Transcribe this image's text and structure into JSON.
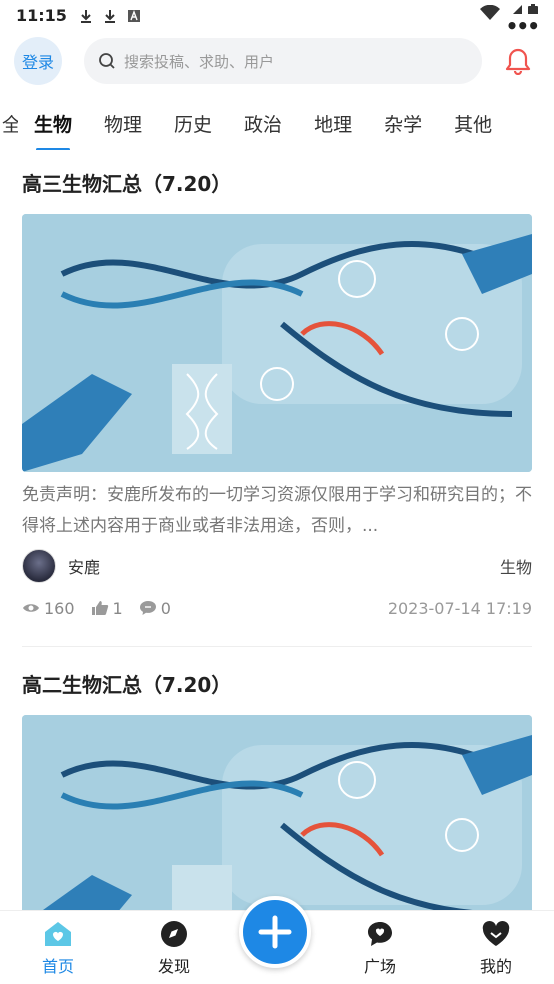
{
  "status_bar": {
    "time": "11:15"
  },
  "header": {
    "login_label": "登录",
    "search_placeholder": "搜索投稿、求助、用户"
  },
  "tabs": {
    "partial_label": "全",
    "items": [
      "生物",
      "物理",
      "历史",
      "政治",
      "地理",
      "杂学",
      "其他"
    ],
    "more": "•••"
  },
  "feed": {
    "posts": [
      {
        "title": "高三生物汇总（7.20）",
        "description": "免责声明：安鹿所发布的一切学习资源仅限用于学习和研究目的；不得将上述内容用于商业或者非法用途，否则，...",
        "author": "安鹿",
        "category": "生物",
        "views": "160",
        "likes": "1",
        "comments": "0",
        "date": "2023-07-14 17:19"
      },
      {
        "title": "高二生物汇总（7.20）"
      }
    ]
  },
  "bottom_nav": {
    "home": "首页",
    "discover": "发现",
    "square": "广场",
    "mine": "我的"
  },
  "colors": {
    "accent": "#1e88e5",
    "image_bg": "#a7cfe0"
  }
}
